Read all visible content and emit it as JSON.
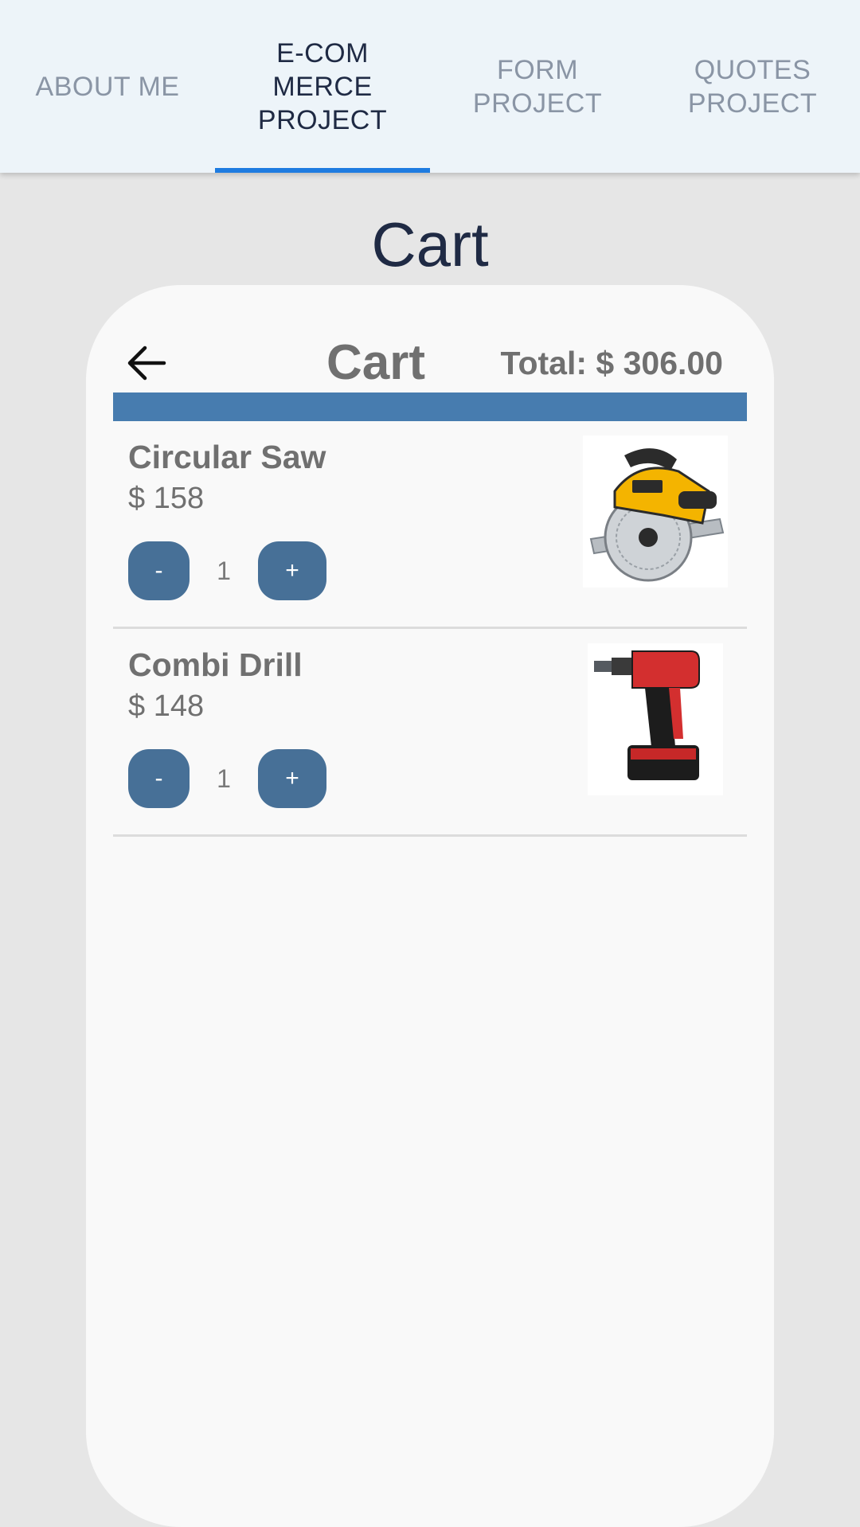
{
  "tabs": [
    {
      "label": "ABOUT ME",
      "active": false
    },
    {
      "label": "E-COM MERCE PROJECT",
      "active": true
    },
    {
      "label": "FORM PROJECT",
      "active": false
    },
    {
      "label": "QUOTES PROJECT",
      "active": false
    }
  ],
  "page": {
    "title": "Cart"
  },
  "cart": {
    "heading": "Cart",
    "total": "Total: $ 306.00",
    "items": [
      {
        "name": "Circular Saw",
        "price": "$ 158",
        "quantity": "1",
        "minus_label": "-",
        "plus_label": "+",
        "image_icon": "circular-saw-image"
      },
      {
        "name": "Combi Drill",
        "price": "$ 148",
        "quantity": "1",
        "minus_label": "-",
        "plus_label": "+",
        "image_icon": "cordless-drill-image"
      }
    ]
  },
  "colors": {
    "tab_indicator": "#1e7be0",
    "header_bar": "#477caf",
    "qty_button": "#477097",
    "page_background": "#e6e6e6"
  }
}
